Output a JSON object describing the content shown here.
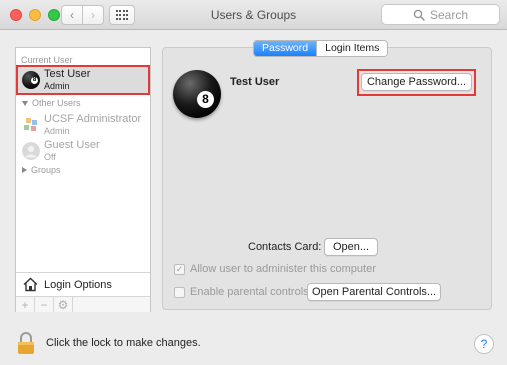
{
  "window": {
    "title": "Users & Groups"
  },
  "toolbar": {
    "back_icon": "chevron-left-icon",
    "forward_icon": "chevron-right-icon",
    "grid_icon": "show-all-grid-icon",
    "search_placeholder": "Search"
  },
  "sidebar": {
    "current_user_label": "Current User",
    "current_user": {
      "name": "Test User",
      "role": "Admin",
      "avatar_icon": "eight-ball-icon"
    },
    "other_users_label": "Other Users",
    "other_users": [
      {
        "name": "UCSF Administrator",
        "role": "Admin",
        "avatar_icon": "colorful-pinwheel-icon"
      },
      {
        "name": "Guest User",
        "role": "Off",
        "avatar_icon": "generic-user-icon"
      }
    ],
    "groups_label": "Groups",
    "login_options_label": "Login Options",
    "tools": {
      "add": "+",
      "remove": "−"
    }
  },
  "main": {
    "tabs": [
      {
        "label": "Password",
        "active": true
      },
      {
        "label": "Login Items",
        "active": false
      }
    ],
    "user_name": "Test User",
    "change_password_button": "Change Password...",
    "contacts_card_label": "Contacts Card:",
    "open_button": "Open...",
    "allow_admin_label": "Allow user to administer this computer",
    "allow_admin_checked": true,
    "parental_controls_label": "Enable parental controls",
    "parental_controls_checked": false,
    "open_parental_controls_button": "Open Parental Controls..."
  },
  "footer": {
    "lock_text": "Click the lock to make changes.",
    "help_label": "?"
  },
  "colors": {
    "selection_highlight": "#e53935",
    "active_tab": "#1a82fb",
    "window_bg": "#ececec"
  }
}
